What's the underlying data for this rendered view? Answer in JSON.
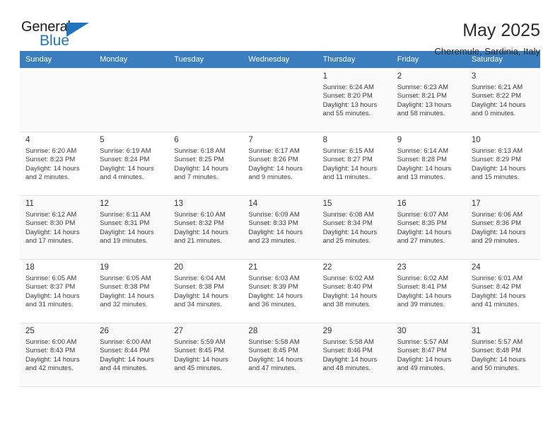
{
  "brand": {
    "word_general": "General",
    "word_blue": "Blue",
    "triangle_color": "#1f74bd"
  },
  "header": {
    "title": "May 2025",
    "location": "Cheremule, Sardinia, Italy",
    "header_bg": "#3a7ebf"
  },
  "weekdays": [
    "Sunday",
    "Monday",
    "Tuesday",
    "Wednesday",
    "Thursday",
    "Friday",
    "Saturday"
  ],
  "weeks": [
    [
      {
        "day": "",
        "sunrise": "",
        "sunset": "",
        "daylight1": "",
        "daylight2": ""
      },
      {
        "day": "",
        "sunrise": "",
        "sunset": "",
        "daylight1": "",
        "daylight2": ""
      },
      {
        "day": "",
        "sunrise": "",
        "sunset": "",
        "daylight1": "",
        "daylight2": ""
      },
      {
        "day": "",
        "sunrise": "",
        "sunset": "",
        "daylight1": "",
        "daylight2": ""
      },
      {
        "day": "1",
        "sunrise": "Sunrise: 6:24 AM",
        "sunset": "Sunset: 8:20 PM",
        "daylight1": "Daylight: 13 hours",
        "daylight2": "and 55 minutes."
      },
      {
        "day": "2",
        "sunrise": "Sunrise: 6:23 AM",
        "sunset": "Sunset: 8:21 PM",
        "daylight1": "Daylight: 13 hours",
        "daylight2": "and 58 minutes."
      },
      {
        "day": "3",
        "sunrise": "Sunrise: 6:21 AM",
        "sunset": "Sunset: 8:22 PM",
        "daylight1": "Daylight: 14 hours",
        "daylight2": "and 0 minutes."
      }
    ],
    [
      {
        "day": "4",
        "sunrise": "Sunrise: 6:20 AM",
        "sunset": "Sunset: 8:23 PM",
        "daylight1": "Daylight: 14 hours",
        "daylight2": "and 2 minutes."
      },
      {
        "day": "5",
        "sunrise": "Sunrise: 6:19 AM",
        "sunset": "Sunset: 8:24 PM",
        "daylight1": "Daylight: 14 hours",
        "daylight2": "and 4 minutes."
      },
      {
        "day": "6",
        "sunrise": "Sunrise: 6:18 AM",
        "sunset": "Sunset: 8:25 PM",
        "daylight1": "Daylight: 14 hours",
        "daylight2": "and 7 minutes."
      },
      {
        "day": "7",
        "sunrise": "Sunrise: 6:17 AM",
        "sunset": "Sunset: 8:26 PM",
        "daylight1": "Daylight: 14 hours",
        "daylight2": "and 9 minutes."
      },
      {
        "day": "8",
        "sunrise": "Sunrise: 6:15 AM",
        "sunset": "Sunset: 8:27 PM",
        "daylight1": "Daylight: 14 hours",
        "daylight2": "and 11 minutes."
      },
      {
        "day": "9",
        "sunrise": "Sunrise: 6:14 AM",
        "sunset": "Sunset: 8:28 PM",
        "daylight1": "Daylight: 14 hours",
        "daylight2": "and 13 minutes."
      },
      {
        "day": "10",
        "sunrise": "Sunrise: 6:13 AM",
        "sunset": "Sunset: 8:29 PM",
        "daylight1": "Daylight: 14 hours",
        "daylight2": "and 15 minutes."
      }
    ],
    [
      {
        "day": "11",
        "sunrise": "Sunrise: 6:12 AM",
        "sunset": "Sunset: 8:30 PM",
        "daylight1": "Daylight: 14 hours",
        "daylight2": "and 17 minutes."
      },
      {
        "day": "12",
        "sunrise": "Sunrise: 6:11 AM",
        "sunset": "Sunset: 8:31 PM",
        "daylight1": "Daylight: 14 hours",
        "daylight2": "and 19 minutes."
      },
      {
        "day": "13",
        "sunrise": "Sunrise: 6:10 AM",
        "sunset": "Sunset: 8:32 PM",
        "daylight1": "Daylight: 14 hours",
        "daylight2": "and 21 minutes."
      },
      {
        "day": "14",
        "sunrise": "Sunrise: 6:09 AM",
        "sunset": "Sunset: 8:33 PM",
        "daylight1": "Daylight: 14 hours",
        "daylight2": "and 23 minutes."
      },
      {
        "day": "15",
        "sunrise": "Sunrise: 6:08 AM",
        "sunset": "Sunset: 8:34 PM",
        "daylight1": "Daylight: 14 hours",
        "daylight2": "and 25 minutes."
      },
      {
        "day": "16",
        "sunrise": "Sunrise: 6:07 AM",
        "sunset": "Sunset: 8:35 PM",
        "daylight1": "Daylight: 14 hours",
        "daylight2": "and 27 minutes."
      },
      {
        "day": "17",
        "sunrise": "Sunrise: 6:06 AM",
        "sunset": "Sunset: 8:36 PM",
        "daylight1": "Daylight: 14 hours",
        "daylight2": "and 29 minutes."
      }
    ],
    [
      {
        "day": "18",
        "sunrise": "Sunrise: 6:05 AM",
        "sunset": "Sunset: 8:37 PM",
        "daylight1": "Daylight: 14 hours",
        "daylight2": "and 31 minutes."
      },
      {
        "day": "19",
        "sunrise": "Sunrise: 6:05 AM",
        "sunset": "Sunset: 8:38 PM",
        "daylight1": "Daylight: 14 hours",
        "daylight2": "and 32 minutes."
      },
      {
        "day": "20",
        "sunrise": "Sunrise: 6:04 AM",
        "sunset": "Sunset: 8:38 PM",
        "daylight1": "Daylight: 14 hours",
        "daylight2": "and 34 minutes."
      },
      {
        "day": "21",
        "sunrise": "Sunrise: 6:03 AM",
        "sunset": "Sunset: 8:39 PM",
        "daylight1": "Daylight: 14 hours",
        "daylight2": "and 36 minutes."
      },
      {
        "day": "22",
        "sunrise": "Sunrise: 6:02 AM",
        "sunset": "Sunset: 8:40 PM",
        "daylight1": "Daylight: 14 hours",
        "daylight2": "and 38 minutes."
      },
      {
        "day": "23",
        "sunrise": "Sunrise: 6:02 AM",
        "sunset": "Sunset: 8:41 PM",
        "daylight1": "Daylight: 14 hours",
        "daylight2": "and 39 minutes."
      },
      {
        "day": "24",
        "sunrise": "Sunrise: 6:01 AM",
        "sunset": "Sunset: 8:42 PM",
        "daylight1": "Daylight: 14 hours",
        "daylight2": "and 41 minutes."
      }
    ],
    [
      {
        "day": "25",
        "sunrise": "Sunrise: 6:00 AM",
        "sunset": "Sunset: 8:43 PM",
        "daylight1": "Daylight: 14 hours",
        "daylight2": "and 42 minutes."
      },
      {
        "day": "26",
        "sunrise": "Sunrise: 6:00 AM",
        "sunset": "Sunset: 8:44 PM",
        "daylight1": "Daylight: 14 hours",
        "daylight2": "and 44 minutes."
      },
      {
        "day": "27",
        "sunrise": "Sunrise: 5:59 AM",
        "sunset": "Sunset: 8:45 PM",
        "daylight1": "Daylight: 14 hours",
        "daylight2": "and 45 minutes."
      },
      {
        "day": "28",
        "sunrise": "Sunrise: 5:58 AM",
        "sunset": "Sunset: 8:45 PM",
        "daylight1": "Daylight: 14 hours",
        "daylight2": "and 47 minutes."
      },
      {
        "day": "29",
        "sunrise": "Sunrise: 5:58 AM",
        "sunset": "Sunset: 8:46 PM",
        "daylight1": "Daylight: 14 hours",
        "daylight2": "and 48 minutes."
      },
      {
        "day": "30",
        "sunrise": "Sunrise: 5:57 AM",
        "sunset": "Sunset: 8:47 PM",
        "daylight1": "Daylight: 14 hours",
        "daylight2": "and 49 minutes."
      },
      {
        "day": "31",
        "sunrise": "Sunrise: 5:57 AM",
        "sunset": "Sunset: 8:48 PM",
        "daylight1": "Daylight: 14 hours",
        "daylight2": "and 50 minutes."
      }
    ]
  ]
}
